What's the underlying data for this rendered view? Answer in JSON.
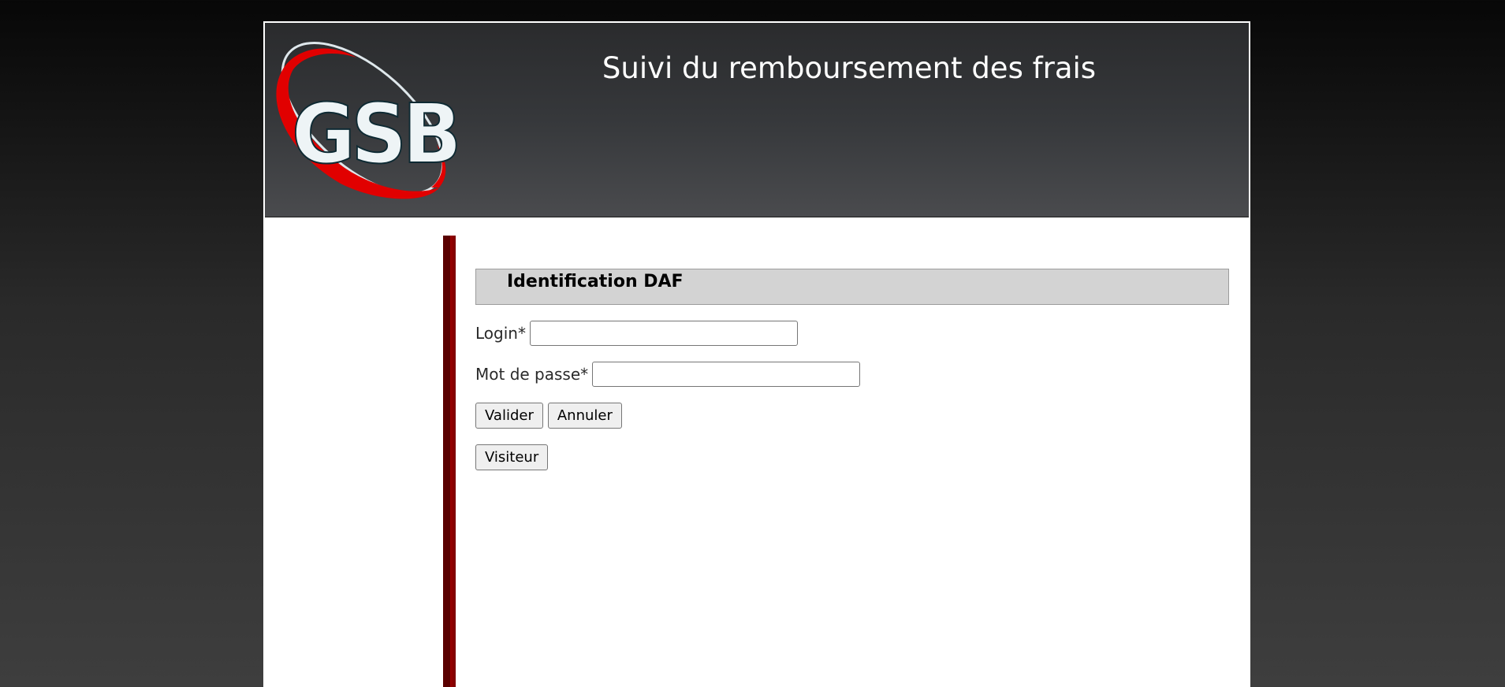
{
  "header": {
    "logo_text": "GSB",
    "title": "Suivi du remboursement des frais"
  },
  "login_form": {
    "section_title": "Identification DAF",
    "login_label": "Login*",
    "login_value": "",
    "password_label": "Mot de passe*",
    "password_value": "",
    "submit_label": "Valider",
    "cancel_label": "Annuler",
    "visitor_label": "Visiteur"
  },
  "colors": {
    "header_bg": "#36383b",
    "accent_red": "#e10000",
    "sidebar_bar": "#7a0000",
    "section_box": "#d3d3d3"
  }
}
